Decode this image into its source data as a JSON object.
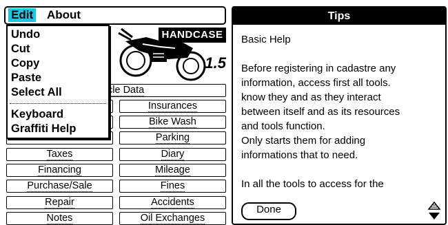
{
  "menubar": {
    "edit": "Edit",
    "about": "About"
  },
  "logo": {
    "brand": "HANDCASE",
    "version": "1.5"
  },
  "edit_menu": {
    "items": [
      "Undo",
      "Cut",
      "Copy",
      "Paste",
      "Select All"
    ],
    "items2": [
      "Keyboard",
      "Graffiti Help"
    ]
  },
  "buttons": {
    "vehicle_data": "Vehicle Data",
    "insurances": "Insurances",
    "bike_wash": "Bike Wash",
    "parking": "Parking",
    "taxes": "Taxes",
    "diary": "Diary",
    "financing": "Financing",
    "mileage": "Mileage",
    "purchase_sale": "Purchase/Sale",
    "fines": "Fines",
    "repair": "Repair",
    "accidents": "Accidents",
    "notes": "Notes",
    "oil_exchanges": "Oil Exchanges"
  },
  "tips": {
    "title": "Tips",
    "heading": "Basic Help",
    "lines": [
      "Before registering in cadastre any",
      "information, access first all tools.",
      "know they and as they interact",
      "between itself and as its resources",
      "and tools function.",
      "Only starts them for adding",
      "informations that to need."
    ],
    "last_line": "In all the tools to access for the",
    "done": "Done"
  }
}
